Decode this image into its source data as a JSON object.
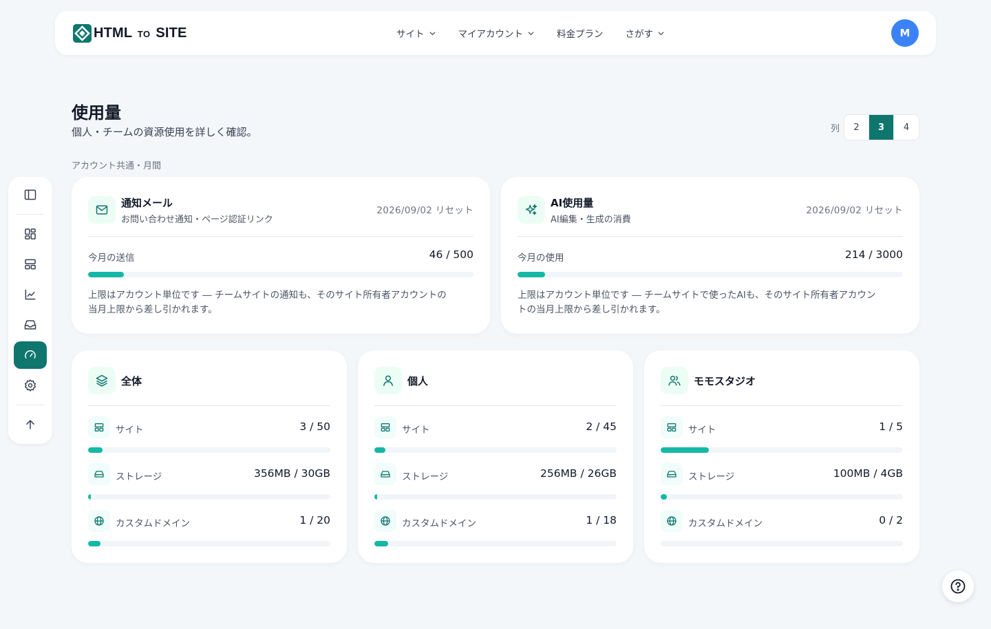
{
  "brand": {
    "name_html": "HTML",
    "name_to": "TO",
    "name_site": "SITE",
    "color": "#0f766e"
  },
  "nav": [
    {
      "label": "サイト",
      "dropdown": true
    },
    {
      "label": "マイアカウント",
      "dropdown": true
    },
    {
      "label": "料金プラン",
      "dropdown": false
    },
    {
      "label": "さがす",
      "dropdown": true
    }
  ],
  "user": {
    "initial": "M",
    "avatar_color": "#3b82f6"
  },
  "sidebar": {
    "items": [
      {
        "icon": "sidebar-panel-icon"
      },
      {
        "icon": "dashboard-grid-icon"
      },
      {
        "icon": "layout-icon"
      },
      {
        "icon": "chart-line-icon"
      },
      {
        "icon": "inbox-icon"
      },
      {
        "icon": "gauge-icon",
        "active": true
      },
      {
        "icon": "gear-icon"
      },
      {
        "icon": "arrow-up-icon"
      }
    ]
  },
  "page": {
    "title": "使用量",
    "subtitle": "個人・チームの資源使用を詳しく確認。",
    "columns_label": "列",
    "columns_options": [
      "2",
      "3",
      "4"
    ],
    "columns_selected": "3",
    "section_label": "アカウント共通・月間"
  },
  "account_cards": [
    {
      "icon": "mail-icon",
      "title": "通知メール",
      "subtitle": "お問い合わせ通知・ページ認証リンク",
      "reset": "2026/09/02 リセット",
      "metric_label": "今月の送信",
      "metric_value": "46 / 500",
      "fill": 0.092,
      "note_line1": "上限はアカウント単位です ― チームサイトの通知も、そのサイト所有者アカウントの",
      "note_line2": "当月上限から差し引かれます。"
    },
    {
      "icon": "sparkles-icon",
      "title": "AI使用量",
      "subtitle": "AI編集・生成の消費",
      "reset": "2026/09/02 リセット",
      "metric_label": "今月の使用",
      "metric_value": "214 / 3000",
      "fill": 0.0713,
      "note_line1": "上限はアカウント単位です ― チームサイトで使ったAIも、そのサイト所有者アカウン",
      "note_line2": "トの当月上限から差し引かれます。"
    }
  ],
  "scope_cards": [
    {
      "icon": "layers-icon",
      "title": "全体",
      "rows": [
        {
          "icon": "layout-icon",
          "label": "サイト",
          "value": "3 / 50",
          "fill": 0.06
        },
        {
          "icon": "drive-icon",
          "label": "ストレージ",
          "value": "356MB / 30GB",
          "fill": 0.0116
        },
        {
          "icon": "globe-icon",
          "label": "カスタムドメイン",
          "value": "1 / 20",
          "fill": 0.05
        }
      ]
    },
    {
      "icon": "user-icon",
      "title": "個人",
      "rows": [
        {
          "icon": "layout-icon",
          "label": "サイト",
          "value": "2 / 45",
          "fill": 0.0444
        },
        {
          "icon": "drive-icon",
          "label": "ストレージ",
          "value": "256MB / 26GB",
          "fill": 0.0096
        },
        {
          "icon": "globe-icon",
          "label": "カスタムドメイン",
          "value": "1 / 18",
          "fill": 0.0556
        }
      ]
    },
    {
      "icon": "users-icon",
      "title": "モモスタジオ",
      "rows": [
        {
          "icon": "layout-icon",
          "label": "サイト",
          "value": "1 / 5",
          "fill": 0.2
        },
        {
          "icon": "drive-icon",
          "label": "ストレージ",
          "value": "100MB / 4GB",
          "fill": 0.0244
        },
        {
          "icon": "globe-icon",
          "label": "カスタムドメイン",
          "value": "0 / 2",
          "fill": 0
        }
      ]
    }
  ],
  "help": {
    "icon": "help-circle-icon"
  },
  "colors": {
    "accent": "#0f766e",
    "bar": "#14b8a6",
    "track": "#f1f5f9",
    "background": "#f4f7fa"
  }
}
